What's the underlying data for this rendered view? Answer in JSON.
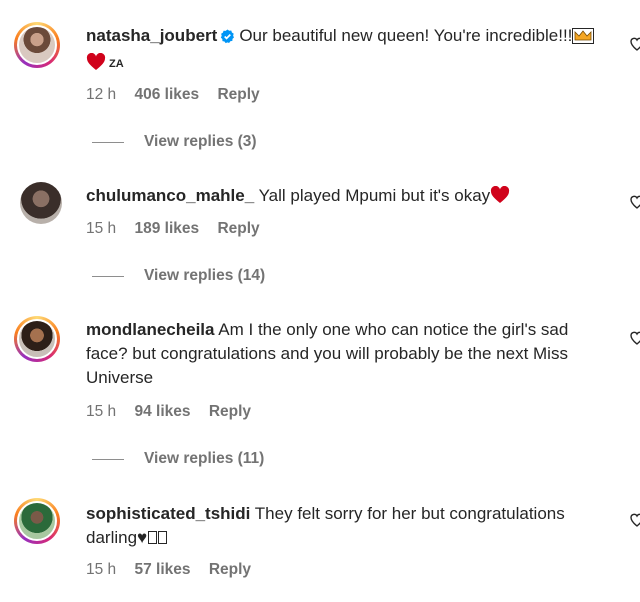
{
  "comments": [
    {
      "username": "natasha_joubert",
      "verified": true,
      "text": "Our beautiful new queen! You're incredible!!!",
      "flag": "ZA",
      "time": "12 h",
      "likes": "406 likes",
      "reply": "Reply",
      "view_replies": "View replies (3)"
    },
    {
      "username": "chulumanco_mahle_",
      "verified": false,
      "text": "Yall played Mpumi but it's okay",
      "time": "15 h",
      "likes": "189 likes",
      "reply": "Reply",
      "view_replies": "View replies (14)"
    },
    {
      "username": "mondlanecheila",
      "verified": false,
      "text": "Am I the only one who can notice the girl's sad face? but congratulations and you will probably be the next Miss Universe",
      "time": "15 h",
      "likes": "94 likes",
      "reply": "Reply",
      "view_replies": "View replies (11)"
    },
    {
      "username": "sophisticated_tshidi",
      "verified": false,
      "text": "They felt sorry for her but congratulations darling",
      "time": "15 h",
      "likes": "57 likes",
      "reply": "Reply"
    }
  ],
  "colors": {
    "text": "#262626",
    "secondary": "#737373",
    "verified_blue": "#0095f6",
    "heart_red": "#ed4956"
  }
}
